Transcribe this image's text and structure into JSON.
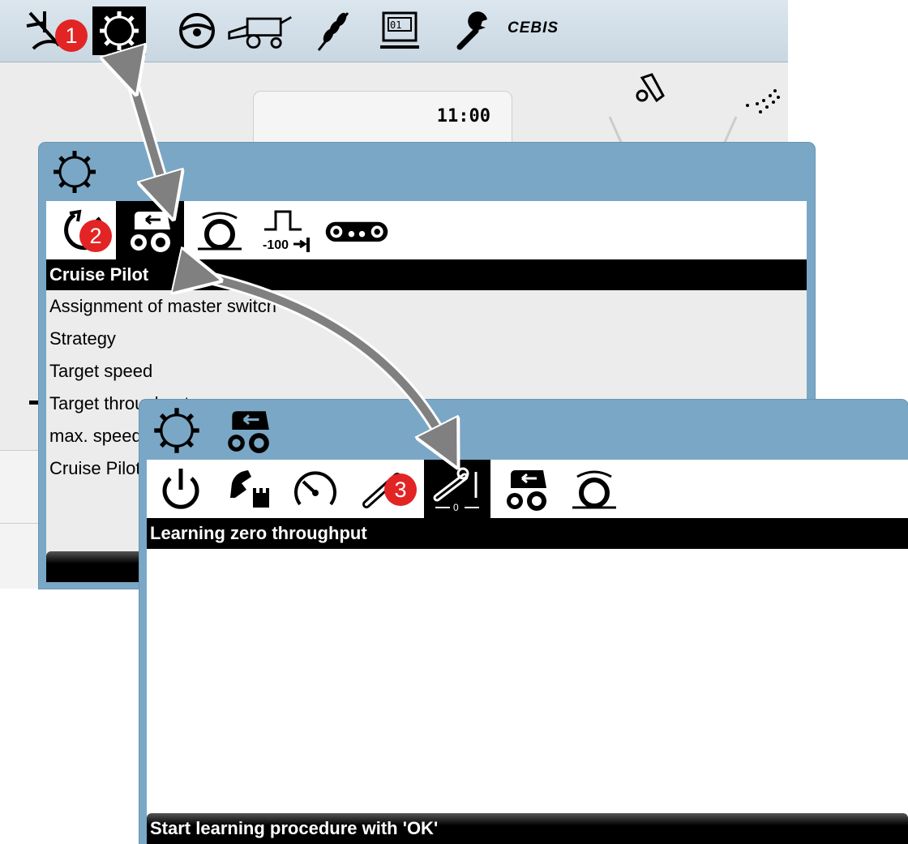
{
  "topbar": {
    "icons": [
      "sensor-off-icon",
      "settings-gear-icon",
      "steering-wheel-icon",
      "combine-harvester-icon",
      "grain-ear-icon",
      "counter-display-icon",
      "wrench-icon"
    ],
    "brand": "CEBIS"
  },
  "base": {
    "clock": "11:00"
  },
  "dialog1": {
    "header_icon": "settings-gear-icon",
    "tabs": [
      "engine-icon",
      "tractor-arrow-icon",
      "drum-speed-icon",
      "pulse-100-icon",
      "track-icon"
    ],
    "selected_tab": 1,
    "title": "Cruise Pilot",
    "items": [
      "Assignment of master switch",
      "Strategy",
      "Target speed",
      "Target throughput",
      "max. speed",
      "Cruise Pilot"
    ]
  },
  "dialog2": {
    "header_icons": [
      "settings-gear-icon",
      "tractor-arrow-icon"
    ],
    "tabs": [
      "power-icon",
      "chess-icon",
      "speedometer-icon",
      "feeder-icon",
      "zero-throughput-icon",
      "tractor-arrow-icon",
      "drum-speed-icon"
    ],
    "selected_tab": 4,
    "title": "Learning zero throughput",
    "status": "Start learning procedure with 'OK'"
  },
  "badges": [
    "1",
    "2",
    "3"
  ],
  "colors": {
    "dialog_frame": "#7aa7c6",
    "badge": "#e32424",
    "arrow": "#808080"
  }
}
